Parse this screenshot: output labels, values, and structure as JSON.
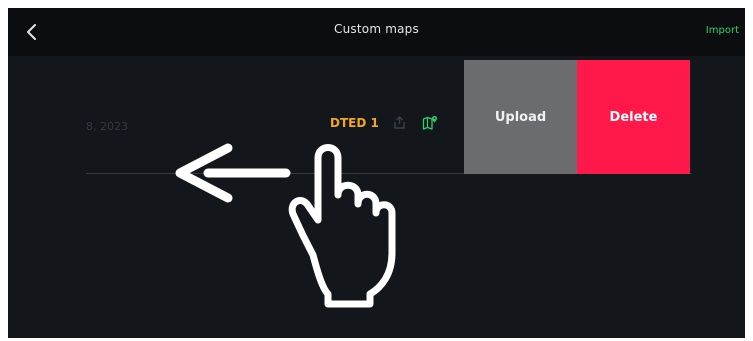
{
  "header": {
    "title": "Custom maps",
    "import_label": "Import"
  },
  "map_row": {
    "date_fragment": "8, 2023",
    "map_type": "DTED 1",
    "upload_label": "Upload",
    "delete_label": "Delete"
  },
  "colors": {
    "import": "#2fd16b",
    "map_type": "#f5a623",
    "upload_bg": "#6b6c6f",
    "delete_bg": "#ff1849"
  },
  "icons": {
    "back": "chevron-left-icon",
    "share": "share-icon",
    "map": "map-pin-icon",
    "gesture_arrow": "arrow-left-icon",
    "gesture_hand": "pointing-hand-icon"
  }
}
